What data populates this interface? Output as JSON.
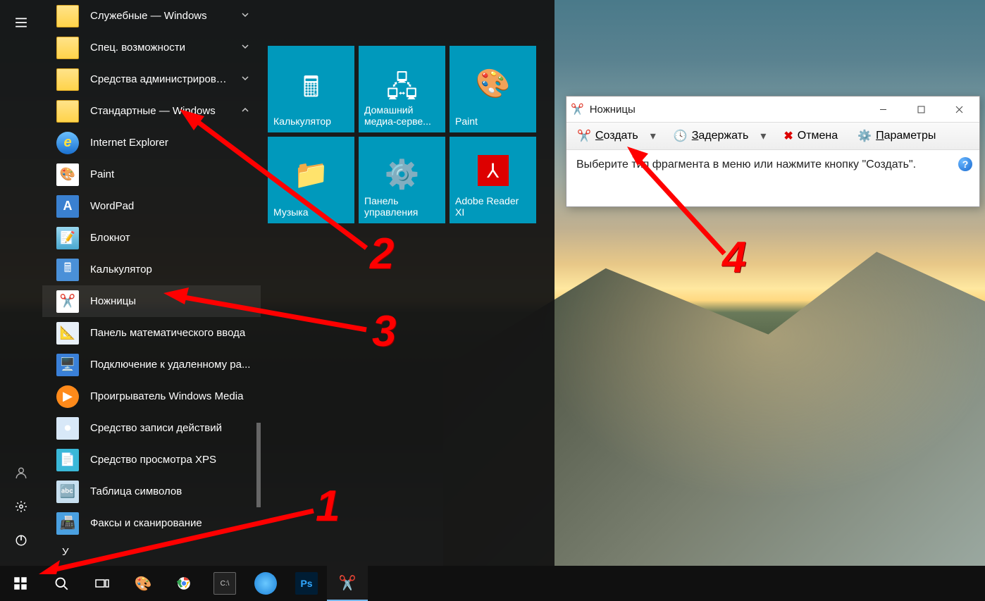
{
  "start_menu": {
    "folders": [
      {
        "label": "Служебные — Windows",
        "chevron": "down"
      },
      {
        "label": "Спец. возможности",
        "chevron": "down"
      },
      {
        "label": "Средства администрировани...",
        "chevron": "down"
      },
      {
        "label": "Стандартные — Windows",
        "chevron": "up"
      }
    ],
    "apps": [
      {
        "label": "Internet Explorer",
        "icon": "ie"
      },
      {
        "label": "Paint",
        "icon": "paint"
      },
      {
        "label": "WordPad",
        "icon": "wordpad"
      },
      {
        "label": "Блокнот",
        "icon": "notepad"
      },
      {
        "label": "Калькулятор",
        "icon": "calc"
      },
      {
        "label": "Ножницы",
        "icon": "snip",
        "hover": true
      },
      {
        "label": "Панель математического ввода",
        "icon": "mathpanel"
      },
      {
        "label": "Подключение к удаленному ра...",
        "icon": "rdp"
      },
      {
        "label": "Проигрыватель Windows Media",
        "icon": "wmp"
      },
      {
        "label": "Средство записи действий",
        "icon": "steps"
      },
      {
        "label": "Средство просмотра XPS",
        "icon": "xps"
      },
      {
        "label": "Таблица символов",
        "icon": "charmap"
      },
      {
        "label": "Факсы и сканирование",
        "icon": "fax"
      }
    ],
    "letter_header": "У",
    "tiles": [
      {
        "label": "Калькулятор"
      },
      {
        "label": "Домашний медиа-серве..."
      },
      {
        "label": "Paint"
      },
      {
        "label": "Музыка"
      },
      {
        "label": "Панель управления"
      },
      {
        "label": "Adobe Reader XI"
      }
    ]
  },
  "snip": {
    "title": "Ножницы",
    "toolbar": {
      "create": "Создать",
      "delay": "Задержать",
      "cancel": "Отмена",
      "params": "Параметры"
    },
    "body": "Выберите тип фрагмента в меню или нажмите кнопку \"Создать\"."
  },
  "annotations": {
    "n1": "1",
    "n2": "2",
    "n3": "3",
    "n4": "4"
  }
}
